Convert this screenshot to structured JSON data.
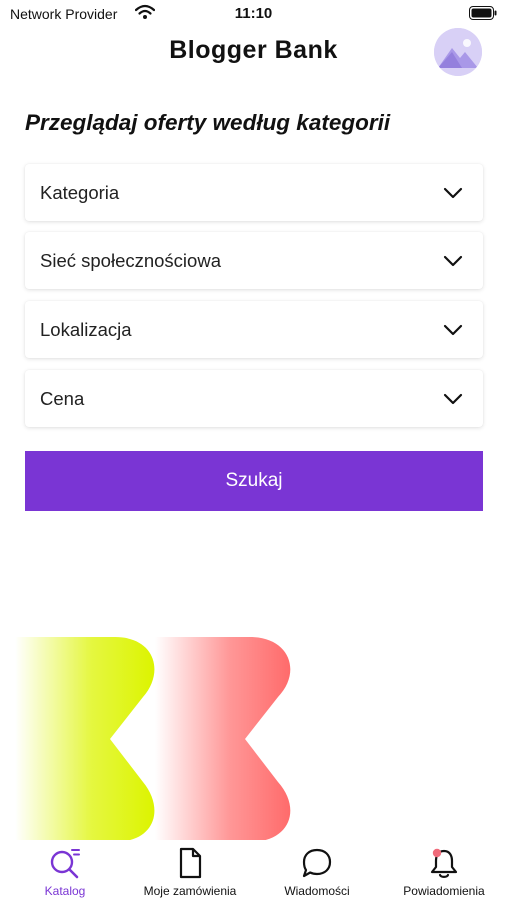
{
  "status_bar": {
    "carrier": "Network Provider",
    "time": "11:10"
  },
  "header": {
    "app_title": "Blogger Bank"
  },
  "page_heading": "Przeglądaj oferty według kategorii",
  "filters": [
    {
      "label": "Kategoria"
    },
    {
      "label": "Sieć społecznościowa"
    },
    {
      "label": "Lokalizacja"
    },
    {
      "label": "Cena"
    }
  ],
  "search_button": {
    "label": "Szukaj"
  },
  "tabs": [
    {
      "label": "Katalog",
      "icon": "search-icon",
      "active": true
    },
    {
      "label": "Moje zamówienia",
      "icon": "document-icon",
      "active": false
    },
    {
      "label": "Wiadomości",
      "icon": "chat-bubble-icon",
      "active": false
    },
    {
      "label": "Powiadomienia",
      "icon": "bell-icon",
      "active": false
    }
  ],
  "colors": {
    "accent": "#7a35d4",
    "logo_lime": "#dcf400",
    "logo_coral": "#ff6b6b",
    "notification_dot": "#f06b7a"
  }
}
